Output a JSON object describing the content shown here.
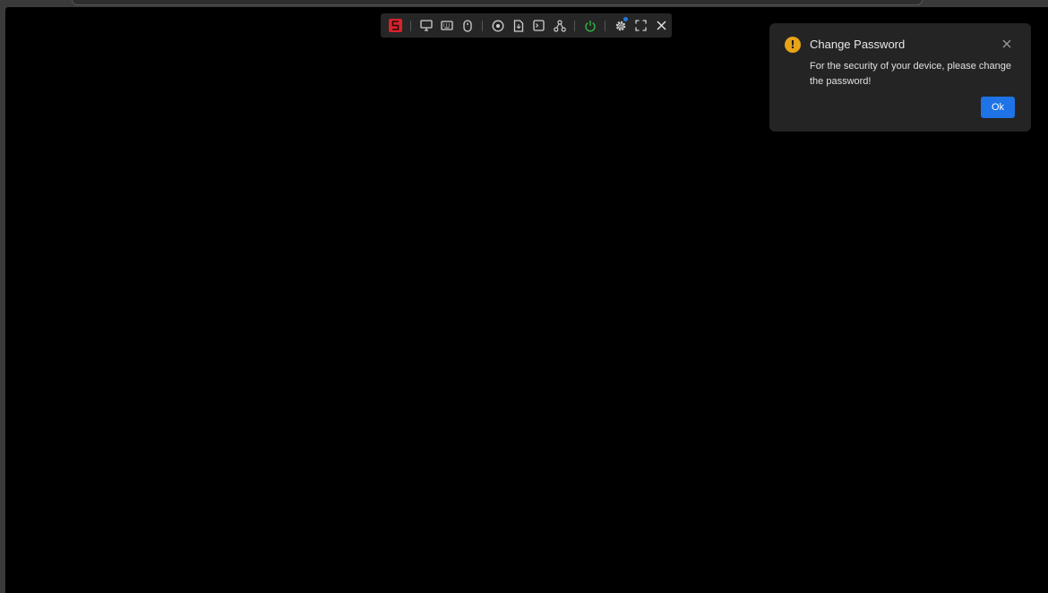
{
  "toolbar": {
    "icons": [
      "logo-icon",
      "monitor-icon",
      "keyboard-icon",
      "mouse-icon",
      "record-icon",
      "file-icon",
      "terminal-icon",
      "network-icon",
      "power-icon",
      "settings-icon",
      "fullscreen-icon",
      "close-icon"
    ],
    "power_color": "#2fb344",
    "logo_color": "#d8232a",
    "badge_color": "#1f7ae0"
  },
  "notification": {
    "title": "Change Password",
    "message": "For the security of your device, please change the password!",
    "ok_label": "Ok",
    "icon": "warning-icon",
    "accent_color": "#e8a319",
    "button_color": "#1e73e6"
  }
}
